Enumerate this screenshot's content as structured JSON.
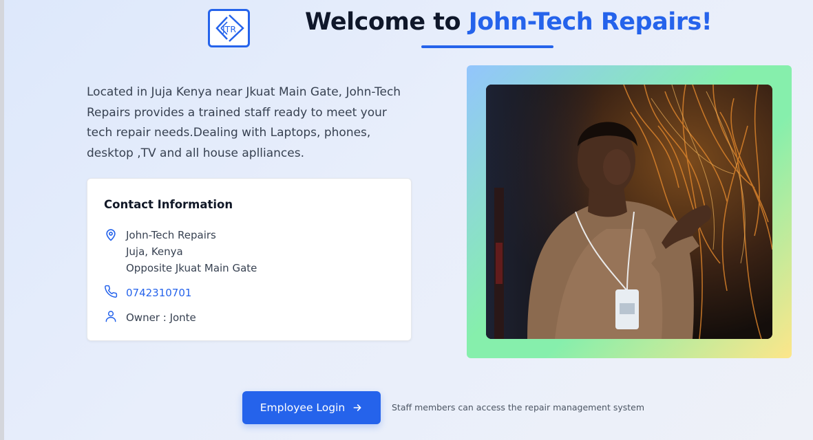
{
  "header": {
    "logo_text": "JTR",
    "title_prefix": "Welcome to ",
    "title_brand": "John-Tech Repairs!"
  },
  "intro": {
    "text": "Located in Juja Kenya near Jkuat Main Gate, John-Tech Repairs provides a trained staff ready to meet your tech repair needs.Dealing with Laptops, phones, desktop ,TV and all house aplliances."
  },
  "contact": {
    "title": "Contact Information",
    "address_line1": "John-Tech Repairs",
    "address_line2": "Juja, Kenya",
    "address_line3": "Opposite Jkuat Main Gate",
    "phone": "0742310701",
    "owner": "Owner : Jonte",
    "icons": {
      "address": "map-pin-icon",
      "phone": "phone-icon",
      "owner": "user-icon"
    }
  },
  "login": {
    "button_label": "Employee Login",
    "button_icon": "arrow-right-icon",
    "note": "Staff members can access the repair management system"
  },
  "colors": {
    "accent": "#2563eb",
    "heading": "#0f172a",
    "frame_gradient": [
      "#93c5fd",
      "#86efac",
      "#fde68a"
    ]
  }
}
